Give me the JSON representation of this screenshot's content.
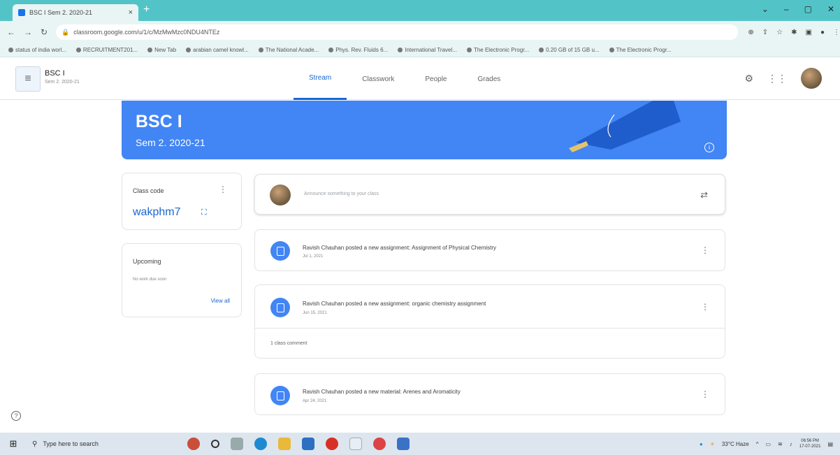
{
  "browser": {
    "tab_title": "BSC I Sem 2. 2020-21",
    "tab_close": "×",
    "new_tab": "+",
    "url": "classroom.google.com/u/1/c/MzMwMzc0NDU4NTEz",
    "bookmarks": [
      "status of india worl...",
      "RECRUITMENT201...",
      "New Tab",
      "arabian camel knowl...",
      "The National Acade...",
      "Phys. Rev. Fluids 6...",
      "International Travel...",
      "The Electronic Progr...",
      "0.20 GB of 15 GB u...",
      "The Electronic Progr..."
    ]
  },
  "header": {
    "class_name": "BSC I",
    "class_sub": "Sem 2. 2020-21",
    "tabs": [
      "Stream",
      "Classwork",
      "People",
      "Grades"
    ],
    "active_tab": "Stream"
  },
  "banner": {
    "title": "BSC I",
    "subtitle": "Sem 2. 2020-21"
  },
  "class_code": {
    "label": "Class code",
    "code": "wakphm7"
  },
  "upcoming": {
    "label": "Upcoming",
    "empty": "No work due soon",
    "view_all": "View all"
  },
  "announce": {
    "placeholder": "Announce something to your class"
  },
  "posts": [
    {
      "title": "Ravish Chauhan posted a new assignment: Assignment of Physical Chemistry",
      "date": "Jul 1, 2021",
      "comments": ""
    },
    {
      "title": "Ravish Chauhan posted a new assignment: organic chemistry assignment",
      "date": "Jun 15, 2021",
      "comments": "1 class comment"
    },
    {
      "title": "Ravish Chauhan posted a new material: Arenes and Aromaticity",
      "date": "Apr 24, 2021",
      "comments": ""
    }
  ],
  "taskbar": {
    "search_placeholder": "Type here to search",
    "weather": "33°C Haze",
    "time": "06:56 PM",
    "date": "17-07-2021"
  },
  "colors": {
    "accent": "#4285f4",
    "active_tab": "#1967d2",
    "chrome": "#52c4c7"
  }
}
